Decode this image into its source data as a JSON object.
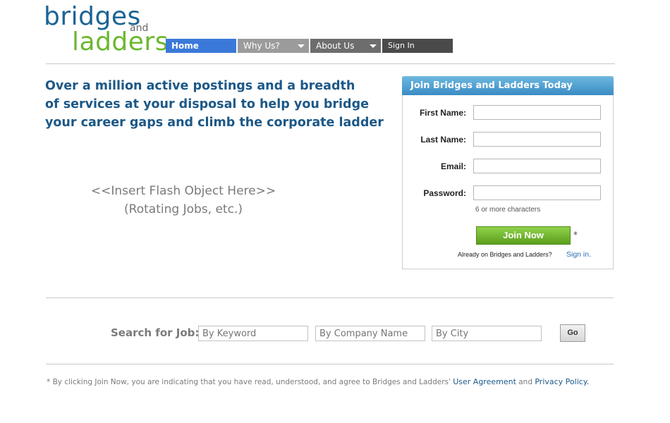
{
  "logo": {
    "word1": "bridges",
    "word2": "and",
    "word3": "ladders"
  },
  "nav": {
    "home": "Home",
    "why": "Why Us?",
    "about": "About Us",
    "signin": "Sign In"
  },
  "tagline": [
    "Over a million active postings and a breadth",
    "of services at your disposal to help you bridge",
    "your career gaps and climb the corporate ladder"
  ],
  "flash": {
    "line1": "<<Insert Flash Object Here>>",
    "line2": "(Rotating Jobs, etc.)"
  },
  "signup": {
    "title": "Join Bridges and Ladders Today",
    "first_name_label": "First Name:",
    "last_name_label": "Last Name:",
    "email_label": "Email:",
    "password_label": "Password:",
    "password_hint": "6 or more characters",
    "join_label": "Join Now",
    "asterisk": "*",
    "already_text": "Already on Bridges and Ladders?",
    "signin_link": "Sign in."
  },
  "search": {
    "label": "Search for Job:",
    "keyword_placeholder": "By Keyword",
    "company_placeholder": "By Company Name",
    "city_placeholder": "By City",
    "go_label": "Go"
  },
  "legal": {
    "text": "* By clicking Join Now, you are indicating that you have read, understood, and agree to Bridges and Ladders'",
    "user_agreement": "User Agreement",
    "and": "and",
    "privacy_policy": "Privacy Policy."
  },
  "colors": {
    "brand_blue": "#1b6494",
    "brand_green": "#6bb82e",
    "nav_active": "#3b79d9"
  }
}
